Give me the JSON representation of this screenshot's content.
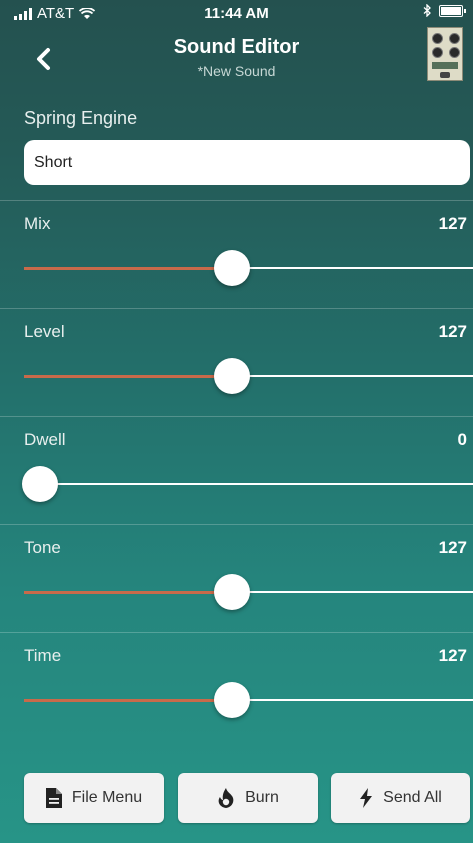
{
  "status_bar": {
    "carrier": "AT&T",
    "time": "11:44 AM",
    "icons": [
      "signal-icon",
      "wifi-icon",
      "bluetooth-icon",
      "battery-icon"
    ]
  },
  "nav": {
    "back_icon": "chevron-left-icon",
    "title": "Sound Editor",
    "subtitle": "*New Sound",
    "thumbnail": "pedal-thumbnail"
  },
  "engine": {
    "label": "Spring Engine",
    "value": "Short"
  },
  "params": [
    {
      "label": "Mix",
      "value": "127",
      "fraction": 0.5
    },
    {
      "label": "Level",
      "value": "127",
      "fraction": 0.5
    },
    {
      "label": "Dwell",
      "value": "0",
      "fraction": 0.0
    },
    {
      "label": "Tone",
      "value": "127",
      "fraction": 0.5
    },
    {
      "label": "Time",
      "value": "127",
      "fraction": 0.5
    }
  ],
  "buttons": {
    "file_menu": "File Menu",
    "burn": "Burn",
    "send_all": "Send All"
  },
  "colors": {
    "accent_fill": "#c86a4a",
    "background_top": "#24514f",
    "background_bottom": "#279487"
  }
}
